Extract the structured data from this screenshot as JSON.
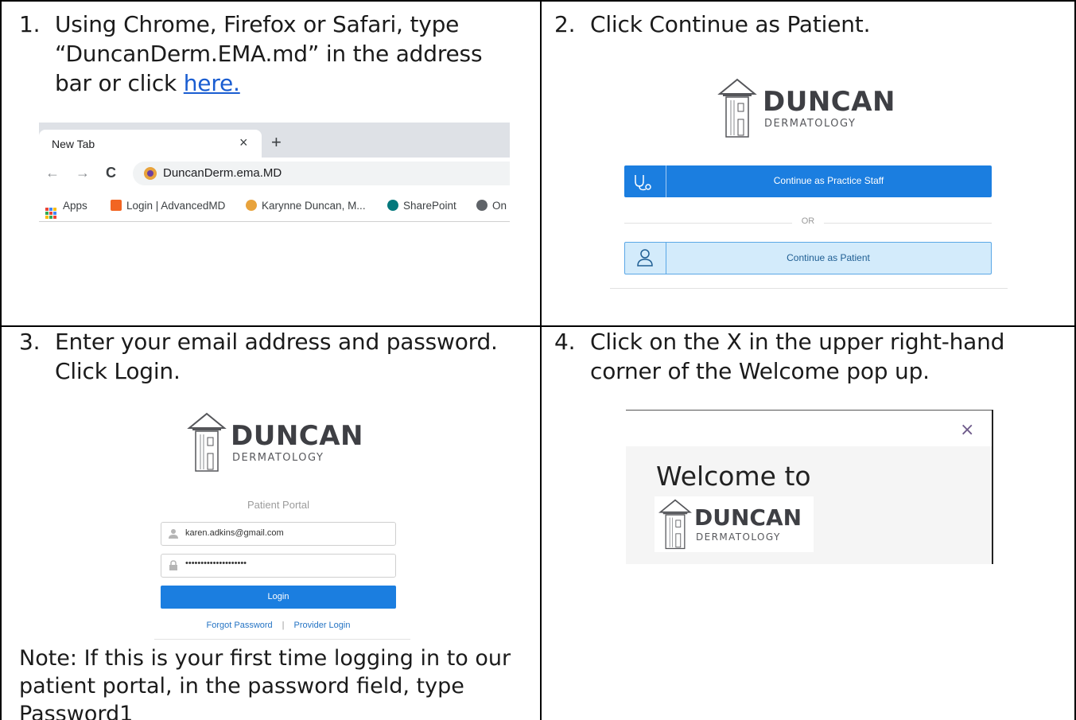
{
  "steps": [
    {
      "number": "1.",
      "line1": "Using Chrome, Firefox or Safari, type",
      "line2": "“DuncanDerm.EMA.md” in the address",
      "line3_prefix": "bar or click ",
      "line3_link": "here."
    },
    {
      "number": "2.",
      "line1": "Click Continue as Patient."
    },
    {
      "number": "3.",
      "line1": "Enter your email address and password.",
      "line2": "Click Login."
    },
    {
      "number": "4.",
      "line1": "Click on the X in the upper right-hand",
      "line2": "corner of the Welcome pop up."
    }
  ],
  "browser": {
    "tab_title": "New Tab",
    "tab_close": "×",
    "new_tab": "+",
    "back": "←",
    "forward": "→",
    "reload": "C",
    "url": "DuncanDerm.ema.MD",
    "bookmarks": [
      "Apps",
      "Login | AdvancedMD",
      "Karynne Duncan, M...",
      "SharePoint",
      "On"
    ]
  },
  "logo": {
    "word": "DUNCAN",
    "sub": "DERMATOLOGY"
  },
  "choose": {
    "staff_label": "Continue as Practice Staff",
    "or": "OR",
    "patient_label": "Continue as Patient"
  },
  "login": {
    "portal_label": "Patient Portal",
    "email": "karen.adkins@gmail.com",
    "password": "••••••••••••••••••••",
    "button": "Login",
    "forgot": "Forgot Password",
    "separator": "|",
    "provider": "Provider Login"
  },
  "note": {
    "line1": "Note:  If this is your first time logging in to our",
    "line2": "patient portal, in the password field, type",
    "line3": "Password1"
  },
  "welcome": {
    "title": "Welcome to",
    "close": "×"
  }
}
